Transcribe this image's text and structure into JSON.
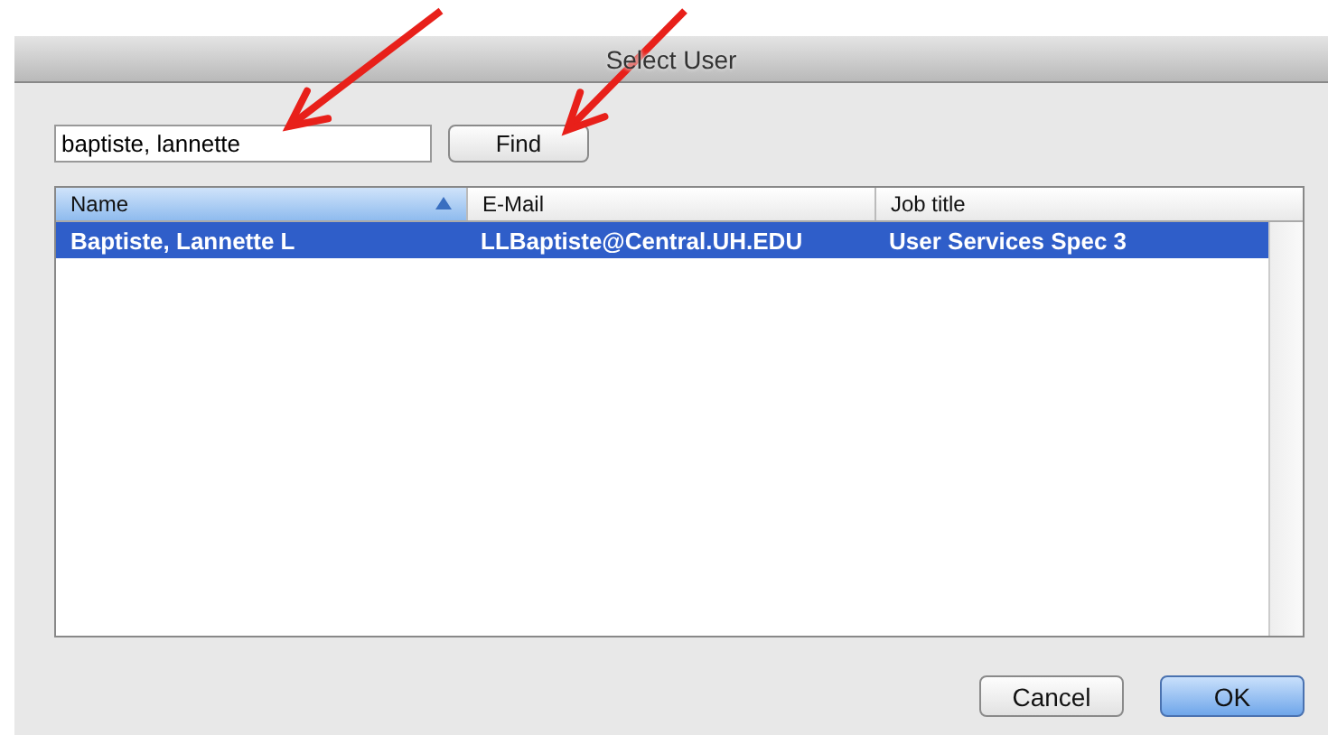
{
  "window": {
    "title": "Select User"
  },
  "search": {
    "value": "baptiste, lannette"
  },
  "find_button": {
    "label": "Find"
  },
  "table": {
    "columns": [
      {
        "label": "Name",
        "sorted": true
      },
      {
        "label": "E-Mail",
        "sorted": false
      },
      {
        "label": "Job title",
        "sorted": false
      }
    ],
    "rows": [
      {
        "cells": [
          "Baptiste, Lannette L",
          "LLBaptiste@Central.UH.EDU",
          "User Services Spec 3"
        ],
        "selected": true
      }
    ]
  },
  "buttons": [
    {
      "label": "Cancel",
      "kind": "normal"
    },
    {
      "label": "OK",
      "kind": "default"
    }
  ]
}
